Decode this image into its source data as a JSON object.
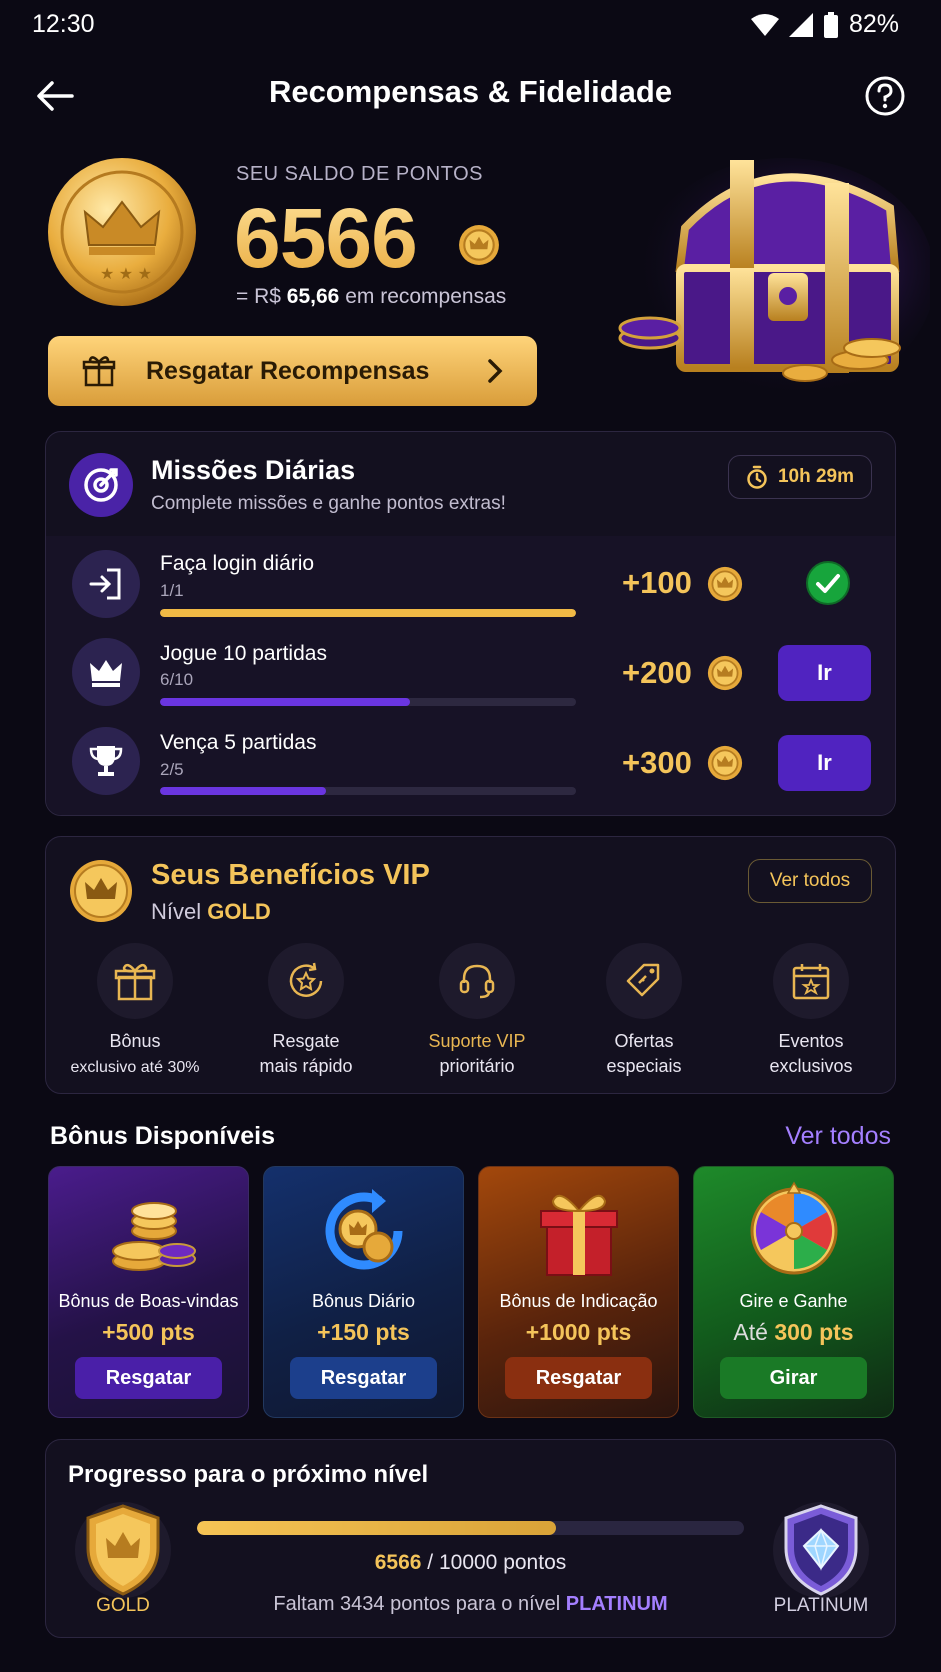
{
  "status_bar": {
    "time": "12:30",
    "battery": "82%"
  },
  "header": {
    "title": "Recompensas & Fidelidade",
    "back_icon": "arrow-left-icon",
    "help_icon": "help-circle-icon"
  },
  "balance": {
    "label": "SEU SALDO DE PONTOS",
    "value": "6566",
    "equivalent_prefix": "= R$",
    "equivalent_amount": "65,66",
    "equivalent_suffix": "em recompensas",
    "redeem_label": "Resgatar Recompensas"
  },
  "missions": {
    "title": "Missões Diárias",
    "subtitle": "Complete missões e ganhe pontos extras!",
    "timer": "10h 29m",
    "items": [
      {
        "name": "Faça login diário",
        "progress_text": "1/1",
        "progress": 1.0,
        "points": "+100",
        "done": true,
        "icon": "login-icon"
      },
      {
        "name": "Jogue 10 partidas",
        "progress_text": "6/10",
        "progress": 0.6,
        "points": "+200",
        "action": "Ir",
        "icon": "crown-icon"
      },
      {
        "name": "Vença 5 partidas",
        "progress_text": "2/5",
        "progress": 0.4,
        "points": "+300",
        "action": "Ir",
        "icon": "trophy-icon"
      }
    ]
  },
  "vip": {
    "title": "Seus Benefícios VIP",
    "level_prefix": "Nível",
    "level": "GOLD",
    "see_all": "Ver todos",
    "benefits": [
      {
        "line1": "Bônus",
        "line2": "exclusivo até 30%",
        "icon": "gift-icon"
      },
      {
        "line1": "Resgate",
        "line2": "mais rápido",
        "icon": "star-refresh-icon"
      },
      {
        "line1": "Suporte VIP",
        "line2": "prioritário",
        "icon": "headset-icon"
      },
      {
        "line1": "Ofertas",
        "line2": "especiais",
        "icon": "tag-icon"
      },
      {
        "line1": "Eventos",
        "line2": "exclusivos",
        "icon": "calendar-star-icon"
      }
    ]
  },
  "bonus": {
    "title": "Bônus Disponíveis",
    "see_all": "Ver todos",
    "items": [
      {
        "name": "Bônus de Boas-vindas",
        "value": "+500 pts",
        "button": "Resgatar"
      },
      {
        "name": "Bônus Diário",
        "value": "+150 pts",
        "button": "Resgatar"
      },
      {
        "name": "Bônus de Indicação",
        "value": "+1000 pts",
        "button": "Resgatar"
      },
      {
        "name": "Gire e Ganhe",
        "value_prefix": "Até",
        "value": "300 pts",
        "button": "Girar"
      }
    ]
  },
  "level_progress": {
    "title": "Progresso para o próximo nível",
    "current_level": "GOLD",
    "next_level": "PLATINUM",
    "current": "6566",
    "target_text": "/ 10000 pontos",
    "progress": 0.6566,
    "need_prefix": "Faltam 3434 pontos para o nível",
    "need_level": "PLATINUM"
  },
  "colors": {
    "gold": "#f4c45a",
    "purple": "#5023c0",
    "background": "#0b0914",
    "link": "#a47fff"
  }
}
